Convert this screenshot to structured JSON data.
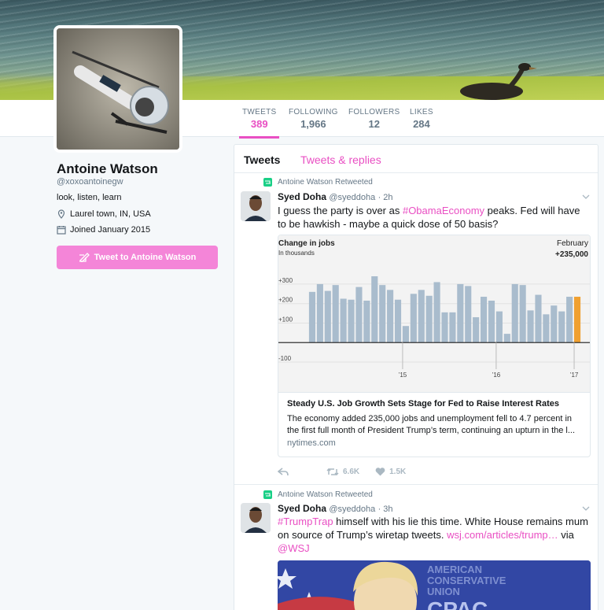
{
  "profile": {
    "name": "Antoine Watson",
    "handle": "@xoxoantoinegw",
    "bio": "look, listen, learn",
    "location": "Laurel town, IN, USA",
    "joined": "Joined January 2015",
    "tweet_to_label": "Tweet to Antoine Watson"
  },
  "stats": [
    {
      "label": "TWEETS",
      "value": "389"
    },
    {
      "label": "FOLLOWING",
      "value": "1,966"
    },
    {
      "label": "FOLLOWERS",
      "value": "12"
    },
    {
      "label": "LIKES",
      "value": "284"
    }
  ],
  "timeline": {
    "tabs": [
      "Tweets",
      "Tweets & replies"
    ]
  },
  "tweets": [
    {
      "retweeted_by": "Antoine Watson Retweeted",
      "author": "Syed Doha",
      "handle": "@syeddoha",
      "time": "· 2h",
      "text_1": "I guess the party is over as ",
      "hashtag": "#ObamaEconomy",
      "text_2": " peaks. Fed will have to be hawkish - maybe a quick dose of 50 basis?",
      "card": {
        "title": "Steady U.S. Job Growth Sets Stage for Fed to Raise Interest Rates",
        "description": "The economy added 235,000 jobs and unemployment fell to 4.7 percent in the first full month of President Trump’s term, continuing an upturn in the l...",
        "source": "nytimes.com"
      },
      "retweets": "6.6K",
      "likes": "1.5K"
    },
    {
      "retweeted_by": "Antoine Watson Retweeted",
      "author": "Syed Doha",
      "handle": "@syeddoha",
      "time": "· 3h",
      "hashtag": "#TrumpTrap",
      "text_1": " himself with his lie this time. White House remains mum on source of Trump’s wiretap tweets. ",
      "link": "wsj.com/articles/trump…",
      "text_2": " via ",
      "mention": "@WSJ",
      "photo_text": [
        "AMERICAN",
        "CONSERVATIVE",
        "UNION",
        "CPAC"
      ]
    }
  ],
  "chart_data": {
    "type": "bar",
    "title": "Change in jobs",
    "subtitle": "In thousands",
    "annotation_label": "February",
    "annotation_value": "+235,000",
    "y_ticks": [
      "+300",
      "+200",
      "+100",
      "-100"
    ],
    "x_ticks": [
      "’15",
      "’16",
      "’17"
    ],
    "ylim": [
      -120,
      340
    ],
    "values": [
      260,
      300,
      265,
      295,
      225,
      220,
      285,
      215,
      340,
      295,
      270,
      220,
      85,
      250,
      270,
      240,
      310,
      155,
      155,
      300,
      290,
      130,
      235,
      215,
      160,
      45,
      300,
      295,
      165,
      245,
      145,
      190,
      160,
      235,
      235
    ],
    "highlight_index": 34,
    "bar_color": "#a9bccd",
    "highlight_color": "#f0a030"
  },
  "colors": {
    "accent": "#e94fc3",
    "button": "#f485d8",
    "retweet_green": "#19cf86"
  }
}
